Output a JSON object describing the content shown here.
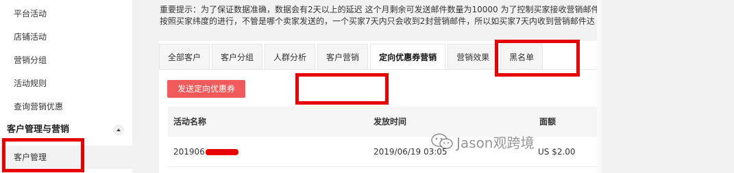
{
  "sidebar": {
    "items": [
      {
        "label": "平台活动"
      },
      {
        "label": "店铺活动"
      },
      {
        "label": "营销分组"
      },
      {
        "label": "活动规则"
      },
      {
        "label": "查询营销优惠"
      }
    ],
    "group": {
      "label": "客户管理与营销"
    },
    "subitems": [
      {
        "label": "客户管理"
      }
    ]
  },
  "notice": {
    "line1": "重要提示：为了保证数据准确，数据会有2天以上的延迟 这个月剩余可发送邮件数量为10000 为了控制买家接收营销邮件",
    "line2": "按照买家纬度的进行，不管是哪个卖家发送的，一个买家7天内只会收到2封营销邮件，所以如买家7天内收到营销邮件达"
  },
  "tabs": [
    {
      "label": "全部客户"
    },
    {
      "label": "客户分组"
    },
    {
      "label": "人群分析"
    },
    {
      "label": "客户营销"
    },
    {
      "label": "定向优惠券营销"
    },
    {
      "label": "营销效果"
    },
    {
      "label": "黑名单"
    }
  ],
  "send_button": {
    "label": "发送定向优惠券"
  },
  "table": {
    "headers": [
      "活动名称",
      "发放时间",
      "面额"
    ],
    "rows": [
      {
        "name": "201906",
        "time": "2019/06/19 03:05",
        "amount": "US $2.00"
      }
    ]
  },
  "watermark": {
    "text": "Jason观跨境"
  },
  "colors": {
    "accent": "#f05a5a",
    "highlight": "#e60000"
  }
}
